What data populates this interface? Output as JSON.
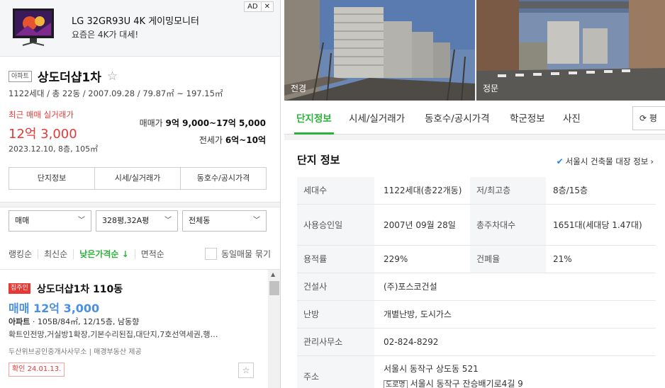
{
  "ad": {
    "title": "LG 32GR93U 4K 게이밍모니터",
    "subtitle": "요즘은 4K가 대세!",
    "badge": "AD",
    "close": "✕"
  },
  "complex": {
    "type_tag": "아파트",
    "name": "상도더샵1차",
    "meta": "1122세대 / 총 22동 / 2007.09.28 / 79.87㎡ ~ 197.15㎡",
    "recent_label": "최근 매매 실거래가",
    "recent_price": "12억 3,000",
    "recent_date": "2023.12.10, 8층, 105㎡",
    "sale_label": "매매가",
    "sale_range": "9억 9,000~17억 5,000",
    "jeonse_label": "전세가",
    "jeonse_range": "6억~10억",
    "seg_tabs": [
      "단지정보",
      "시세/실거래가",
      "동호수/공시가격"
    ]
  },
  "filters": {
    "trade": "매매",
    "area": "328평,32A평",
    "dong": "전체동"
  },
  "sorts": {
    "items": [
      "랭킹순",
      "최신순",
      "낮은가격순 ↓",
      "면적순"
    ],
    "same_listing": "동일매물 묶기"
  },
  "listing": {
    "owner_badge": "집주인",
    "name": "상도더샵1차 110동",
    "price": "매매 12억 3,000",
    "info_bold": "아파트",
    "info": " · 105B/84㎡, 12/15층, 남동향",
    "desc": "확트인전망,거실방1확장,기본수리된집,대단지,7호선역세권,행…",
    "agent": "두산위브공인중개사사무소 | 매경부동산 제공",
    "confirm": "확인 24.01.13.",
    "fav": "☆"
  },
  "photos": {
    "front": "전경",
    "gate": "정문"
  },
  "tabs": {
    "items": [
      "단지정보",
      "시세/실거래가",
      "동호수/공시가격",
      "학군정보",
      "사진"
    ],
    "compare": "⟳ 평"
  },
  "info": {
    "title": "단지 정보",
    "link": "서울시 건축물 대장 정보",
    "rows": [
      {
        "k1": "세대수",
        "v1": "1122세대(총22개동)",
        "k2": "저/최고층",
        "v2": "8층/15층"
      },
      {
        "k1": "사용승인일",
        "v1": "2007년 09월 28일",
        "k2": "총주차대수",
        "v2": "1651대(세대당 1.47대)"
      },
      {
        "k1": "용적률",
        "v1": "229%",
        "k2": "건폐율",
        "v2": "21%"
      },
      {
        "k1": "건설사",
        "v1": "(주)포스코건설"
      },
      {
        "k1": "난방",
        "v1": "개별난방, 도시가스"
      },
      {
        "k1": "관리사무소",
        "v1": "02-824-8292"
      },
      {
        "k1": "주소",
        "v1": "서울시 동작구 상도동 521",
        "road_tag": "도로명",
        "v1b": "서울시 동작구 잔승배기로4길 9"
      }
    ]
  }
}
